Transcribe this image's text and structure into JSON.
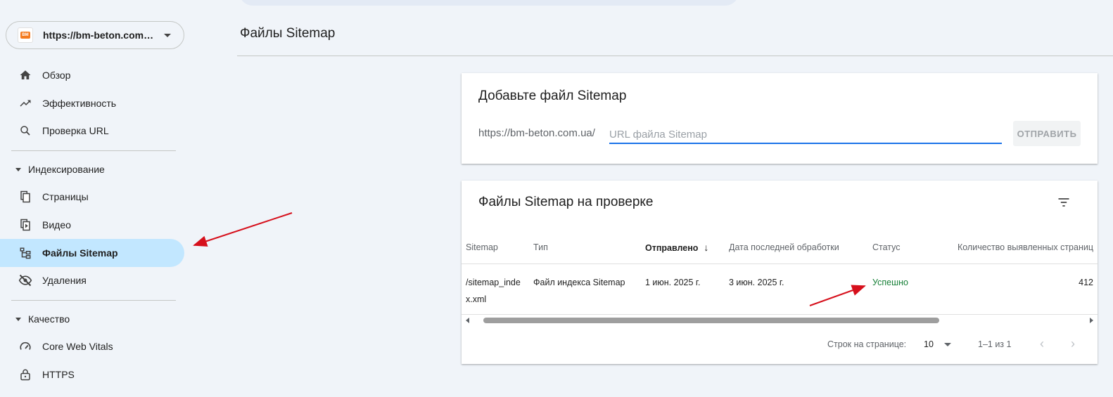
{
  "property": {
    "url": "https://bm-beton.com.ua/",
    "favicon_text": "BM"
  },
  "nav": {
    "overview": "Обзор",
    "performance": "Эффективность",
    "url_inspection": "Проверка URL",
    "indexing_header": "Индексирование",
    "pages": "Страницы",
    "video": "Видео",
    "sitemaps": "Файлы Sitemap",
    "removals": "Удаления",
    "quality_header": "Качество",
    "cwv": "Core Web Vitals",
    "https": "HTTPS"
  },
  "page_title": "Файлы Sitemap",
  "add_card": {
    "title": "Добавьте файл Sitemap",
    "prefix": "https://bm-beton.com.ua/",
    "placeholder": "URL файла Sitemap",
    "submit": "ОТПРАВИТЬ"
  },
  "list_card": {
    "title": "Файлы Sitemap на проверке",
    "columns": [
      "Sitemap",
      "Тип",
      "Отправлено",
      "Дата последней обработки",
      "Статус",
      "Количество выявленных страниц"
    ],
    "rows": [
      {
        "sitemap": "/sitemap_index.xml",
        "type": "Файл индекса Sitemap",
        "submitted": "1 июн. 2025 г.",
        "last_read": "3 июн. 2025 г.",
        "status": "Успешно",
        "discovered": "412"
      }
    ],
    "pagination": {
      "rows_label": "Строк на странице:",
      "rows_value": "10",
      "range": "1–1 из 1"
    }
  },
  "colors": {
    "accent": "#1a73e8",
    "active_bg": "#c2e7ff",
    "success": "#188038",
    "annotation": "#d6101c"
  }
}
